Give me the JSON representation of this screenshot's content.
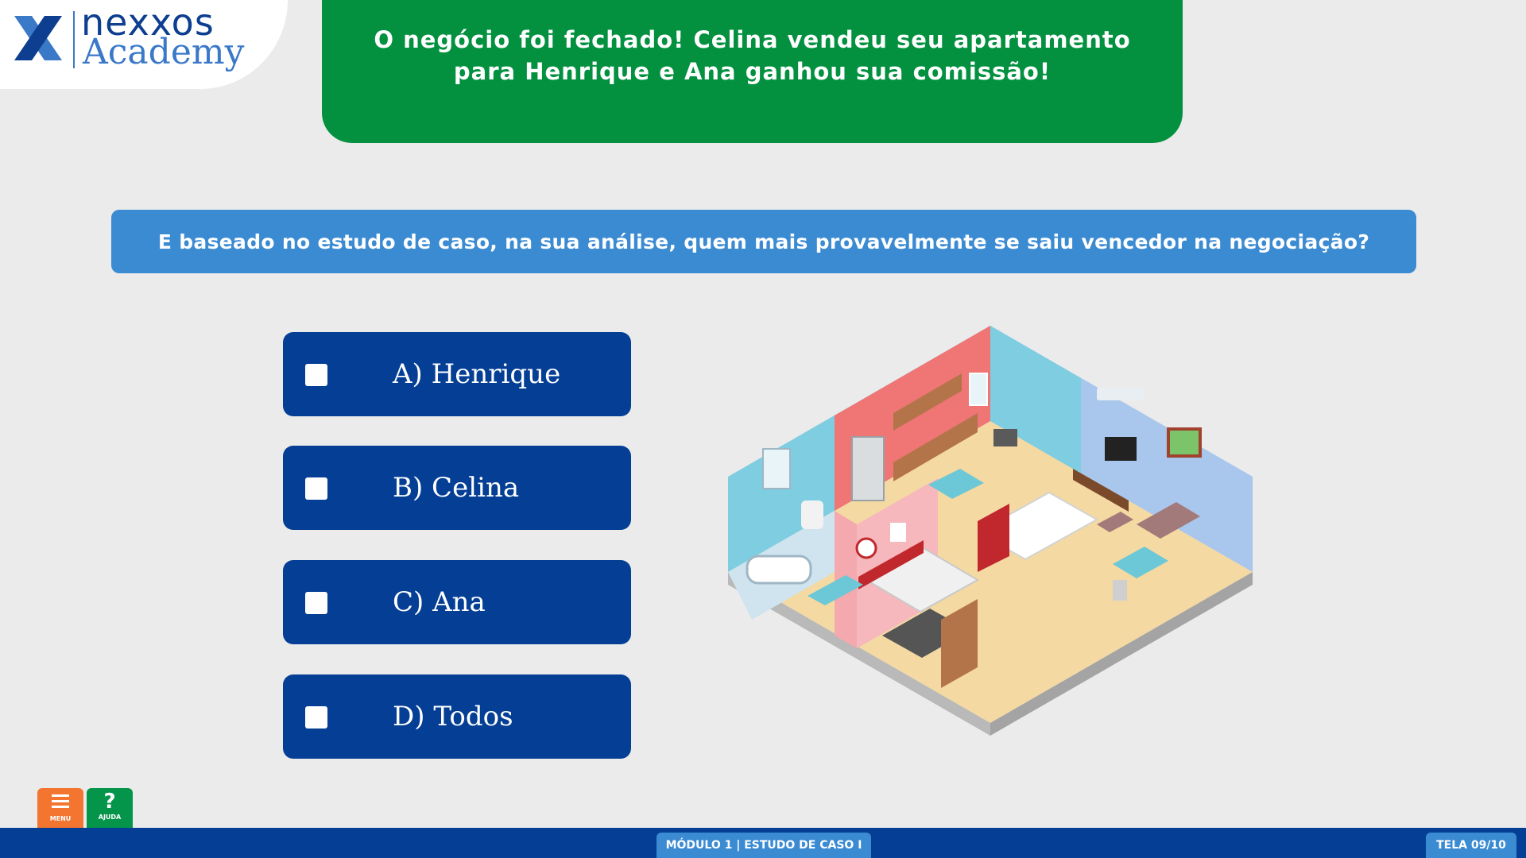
{
  "logo": {
    "name_top": "nexxos",
    "name_bottom": "Academy"
  },
  "banner": {
    "text": "O negócio foi fechado! Celina vendeu seu apartamento para Henrique e Ana ganhou sua comissão!"
  },
  "question": {
    "text": "E baseado no estudo de caso, na sua análise, quem mais provavelmente se saiu vencedor na negociação?"
  },
  "options": [
    {
      "label": "A) Henrique",
      "checked": false
    },
    {
      "label": "B) Celina",
      "checked": false
    },
    {
      "label": "C) Ana",
      "checked": false
    },
    {
      "label": "D) Todos",
      "checked": false
    }
  ],
  "toolbar": {
    "menu_icon": "hamburger-icon",
    "menu_label": "MENU",
    "help_icon": "question-mark-icon",
    "help_symbol": "?",
    "help_label": "AJUDA"
  },
  "footer": {
    "module": "MÓDULO 1 | ESTUDO DE CASO I",
    "page": "TELA 09/10"
  },
  "colors": {
    "background": "#ebebeb",
    "banner_green": "#039140",
    "question_blue": "#3b8bd3",
    "option_navy": "#043f95",
    "menu_orange": "#f47530",
    "help_green": "#05954a"
  }
}
